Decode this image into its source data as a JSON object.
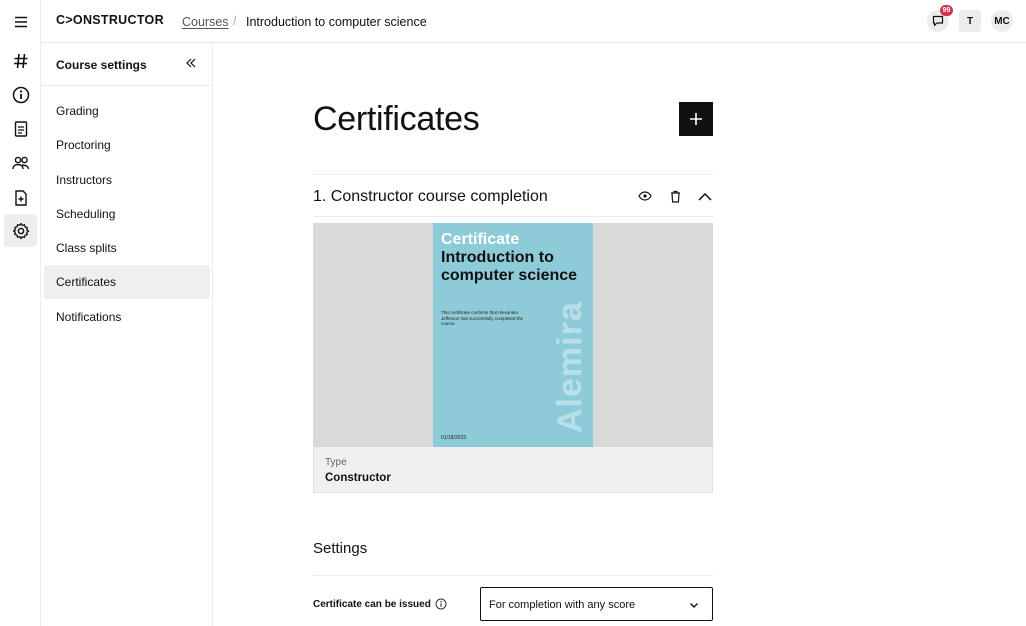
{
  "brand": {
    "logo": "C>ONSTRUCTOR"
  },
  "breadcrumb": {
    "parent": "Courses",
    "separator": "/",
    "current": "Introduction to computer science"
  },
  "topbar": {
    "notifications_count": "99",
    "tenant_initial": "T",
    "user_initials": "MC"
  },
  "rail": {
    "icons": [
      "menu-icon",
      "hash-icon",
      "info-icon",
      "document-icon",
      "users-icon",
      "add-file-icon",
      "gear-icon"
    ],
    "active": "gear-icon"
  },
  "settings_panel": {
    "title": "Course settings",
    "items": [
      {
        "label": "Grading"
      },
      {
        "label": "Proctoring"
      },
      {
        "label": "Instructors"
      },
      {
        "label": "Scheduling"
      },
      {
        "label": "Class splits"
      },
      {
        "label": "Certificates",
        "active": true
      },
      {
        "label": "Notifications"
      }
    ]
  },
  "main": {
    "title": "Certificates",
    "certificate": {
      "name": "1. Constructor course completion",
      "preview": {
        "label": "Certificate",
        "title": "Introduction to computer science",
        "body": "This certificate confirms that Alexander Jefferson has successfully completed the course.",
        "date": "01/18/2023",
        "watermark": "Alemira"
      },
      "type_label": "Type",
      "type_value": "Constructor"
    },
    "settings": {
      "title": "Settings",
      "issue_label": "Certificate can be issued",
      "issue_value": "For completion with any score"
    }
  },
  "colors": {
    "accent": "#111111",
    "badge": "#d9324a",
    "card": "#8ecbd8"
  }
}
